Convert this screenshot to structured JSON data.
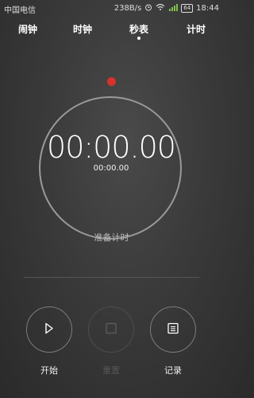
{
  "status_bar": {
    "carrier": "中国电信",
    "net_speed": "238B/s",
    "battery": "64",
    "time": "18:44"
  },
  "tabs": [
    {
      "label": "闹钟"
    },
    {
      "label": "时钟"
    },
    {
      "label": "秒表",
      "selected": true
    },
    {
      "label": "计时"
    }
  ],
  "stopwatch": {
    "main_time": "00:00.00",
    "lap_time": "00:00.00",
    "status": "准备计时"
  },
  "controls": {
    "start_label": "开始",
    "reset_label": "重置",
    "record_label": "记录"
  },
  "colors": {
    "accent": "#d6312b"
  }
}
